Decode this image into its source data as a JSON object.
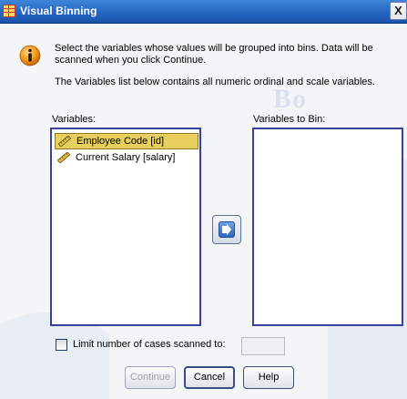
{
  "window": {
    "title": "Visual Binning",
    "close_glyph": "X"
  },
  "info": {
    "icon": "info-icon",
    "line1": "Select the variables whose values will be grouped into bins. Data will be scanned when you click Continue.",
    "line2": "The Variables list below contains all numeric ordinal and scale variables."
  },
  "variables": {
    "label": "Variables:",
    "items": [
      {
        "label": "Employee Code [id]",
        "icon": "ruler-icon",
        "selected": true
      },
      {
        "label": "Current Salary [salary]",
        "icon": "ruler-icon",
        "selected": false
      }
    ]
  },
  "variables_to_bin": {
    "label": "Variables to Bin:",
    "items": []
  },
  "move_button": {
    "icon": "arrow-right-icon"
  },
  "limit": {
    "label": "Limit number of cases scanned to:",
    "checked": false,
    "value": ""
  },
  "buttons": {
    "continue": "Continue",
    "cancel": "Cancel",
    "help": "Help"
  },
  "colors": {
    "titlebar": "#2566c2",
    "selection": "#e9cf5d",
    "listbox_border": "#3a3f9e"
  }
}
